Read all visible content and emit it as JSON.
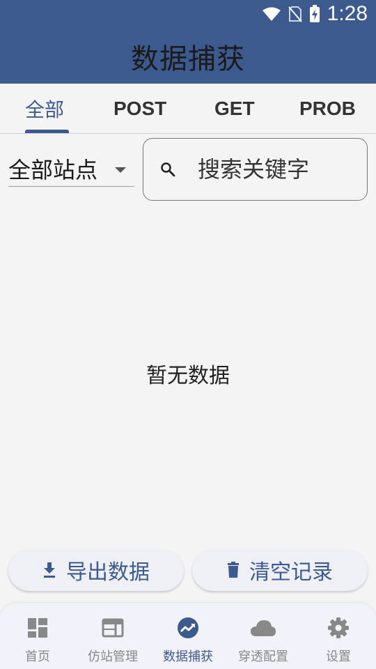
{
  "status_bar": {
    "time": "1:28",
    "icons": [
      "wifi-icon",
      "no-sim-icon",
      "battery-charging-icon"
    ]
  },
  "app_title": "数据捕获",
  "tabs": [
    {
      "label": "全部",
      "active": true
    },
    {
      "label": "POST",
      "active": false
    },
    {
      "label": "GET",
      "active": false
    },
    {
      "label": "PROB",
      "active": false
    }
  ],
  "filter": {
    "site_select_value": "全部站点",
    "search_placeholder": "搜索关键字"
  },
  "empty_state": "暂无数据",
  "actions": {
    "export_label": "导出数据",
    "clear_label": "清空记录"
  },
  "bottom_nav": [
    {
      "label": "首页",
      "icon": "dashboard-icon",
      "active": false
    },
    {
      "label": "仿站管理",
      "icon": "web-window-icon",
      "active": false
    },
    {
      "label": "数据捕获",
      "icon": "trending-up-icon",
      "active": true
    },
    {
      "label": "穿透配置",
      "icon": "cloud-icon",
      "active": false
    },
    {
      "label": "设置",
      "icon": "gear-icon",
      "active": false
    }
  ],
  "colors": {
    "primary": "#3d5a8f",
    "background": "#f4f4f4",
    "nav_inactive": "#888888"
  }
}
